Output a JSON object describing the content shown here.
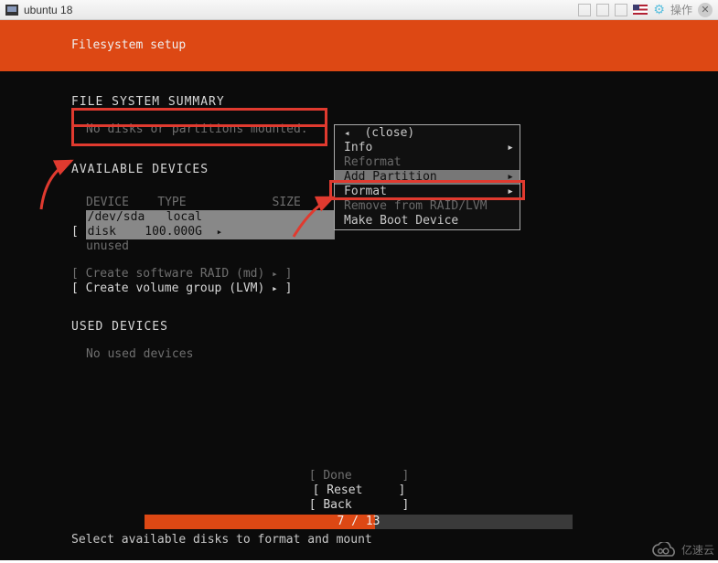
{
  "titlebar": {
    "title": "ubuntu 18",
    "actions_label": "操作"
  },
  "header": {
    "title": "Filesystem setup"
  },
  "summary": {
    "heading": "FILE SYSTEM SUMMARY",
    "empty_text": "No disks or partitions mounted."
  },
  "devices": {
    "heading": "AVAILABLE DEVICES",
    "columns": {
      "device": "DEVICE",
      "type": "TYPE",
      "size": "SIZE"
    },
    "selected": {
      "open_bracket": "[",
      "device": "/dev/sda",
      "type": "local disk",
      "size": "100.000G",
      "arrow": "▸"
    },
    "unused": "unused",
    "options": [
      {
        "label": "Create software RAID (md)",
        "arrow": "▸",
        "dim": true
      },
      {
        "label": "Create volume group (LVM)",
        "arrow": "▸",
        "dim": false
      }
    ]
  },
  "used": {
    "heading": "USED DEVICES",
    "empty_text": "No used devices"
  },
  "popup": {
    "close": "(close)",
    "items": [
      {
        "label": "Info",
        "submenu": true,
        "disabled": false
      },
      {
        "label": "Reformat",
        "submenu": false,
        "disabled": true
      },
      {
        "label": "Add Partition",
        "submenu": true,
        "disabled": false,
        "selected": true
      },
      {
        "label": "Format",
        "submenu": true,
        "disabled": false
      },
      {
        "label": "Remove from RAID/LVM",
        "submenu": false,
        "disabled": true
      },
      {
        "label": "Make Boot Device",
        "submenu": false,
        "disabled": false
      }
    ]
  },
  "buttons": {
    "done": "Done",
    "reset": "Reset",
    "back": "Back"
  },
  "progress": {
    "current": 7,
    "total": 13,
    "text": "7 / 13"
  },
  "hint": "Select available disks to format and mount",
  "watermark": "亿速云"
}
